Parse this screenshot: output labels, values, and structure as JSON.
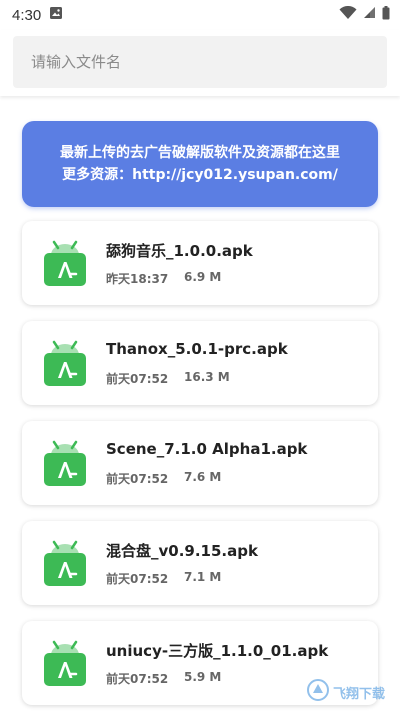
{
  "status_bar": {
    "time": "4:30"
  },
  "search": {
    "placeholder": "请输入文件名",
    "value": ""
  },
  "banner": {
    "line1": "最新上传的去广告破解版软件及资源都在这里",
    "line2": "更多资源：http://jcy012.ysupan.com/"
  },
  "files": [
    {
      "name": "舔狗音乐_1.0.0.apk",
      "time": "昨天18:37",
      "size": "6.9 M"
    },
    {
      "name": "Thanox_5.0.1-prc.apk",
      "time": "前天07:52",
      "size": "16.3 M"
    },
    {
      "name": "Scene_7.1.0 Alpha1.apk",
      "time": "前天07:52",
      "size": "7.6 M"
    },
    {
      "name": "混合盘_v0.9.15.apk",
      "time": "前天07:52",
      "size": "7.1 M"
    },
    {
      "name": "uniucy-三方版_1.1.0_01.apk",
      "time": "前天07:52",
      "size": "5.9 M"
    }
  ],
  "icons": {
    "file": "apk-file-icon",
    "image": "image-icon",
    "wifi": "wifi-icon",
    "signal": "signal-icon",
    "battery": "battery-icon"
  },
  "colors": {
    "banner": "#5b7ee3",
    "apk_green": "#3dba55"
  },
  "watermark": {
    "text": "飞翔下载"
  }
}
